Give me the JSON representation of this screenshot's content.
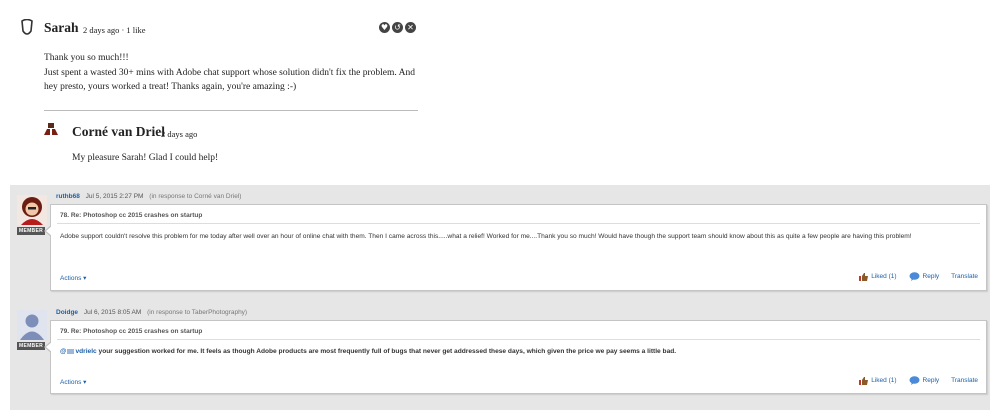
{
  "comments": [
    {
      "author": "Sarah",
      "meta": "2 days ago · 1 like",
      "body": [
        "Thank you so much!!!",
        "Just spent a wasted 30+ mins with Adobe chat support whose solution didn't fix the problem. And hey presto, yours worked a treat! Thanks again, you're amazing :-)"
      ]
    },
    {
      "author": "Corné van Driel",
      "meta": "2 days ago",
      "body": [
        "My pleasure Sarah! Glad I could help!"
      ]
    }
  ],
  "posts": [
    {
      "user": "ruthb68",
      "date": "Jul 5, 2015 2:27 PM",
      "in_response": "(in response to Corné van Driel)",
      "badge": "MEMBER",
      "title": "78. Re: Photoshop cc 2015 crashes on startup",
      "body": "Adobe support couldn't resolve this problem for me today after well over an hour of online chat with them. Then I came across this.....what a relief! Worked for me....Thank you so much! Would have though the support team should know about this as quite a few people are having this problem!",
      "actions": "Actions",
      "liked": "Liked (1)",
      "reply": "Reply",
      "translate": "Translate"
    },
    {
      "user": "Doidge",
      "date": "Jul 6, 2015 8:05 AM",
      "in_response": "(in response to TaberPhotography)",
      "badge": "MEMBER",
      "title": "79. Re: Photoshop cc 2015 crashes on startup",
      "mention_prefix": "@",
      "mention": "vdrielc",
      "body": "your suggestion worked for me. It feels as though Adobe products are most frequently full of bugs that never get addressed these days, which given the price we pay seems a little bad.",
      "actions": "Actions",
      "liked": "Liked (1)",
      "reply": "Reply",
      "translate": "Translate"
    }
  ],
  "colors": {
    "link": "#1d5fa6",
    "panel": "#e6e6e6",
    "badge": "#555555"
  },
  "icons": [
    "person-outline-icon",
    "heart-icon",
    "reply-icon",
    "close-icon",
    "thumbs-up-icon",
    "speech-bubble-icon",
    "dropdown-arrow-icon"
  ]
}
